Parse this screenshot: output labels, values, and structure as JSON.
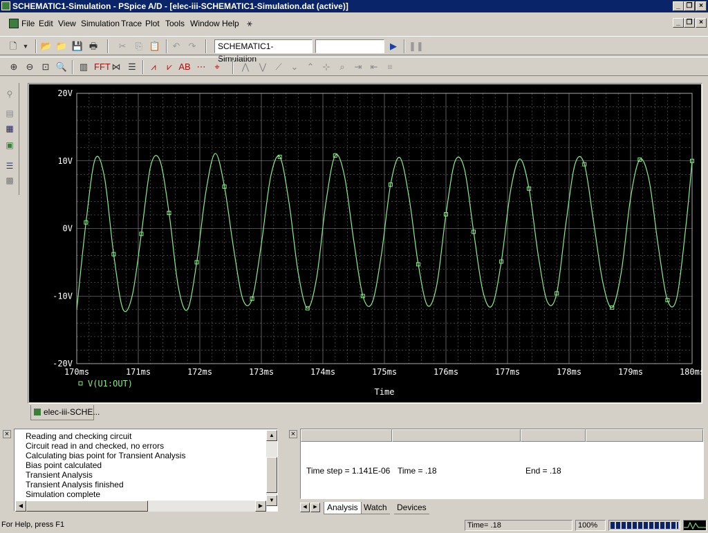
{
  "window": {
    "title": "SCHEMATIC1-Simulation - PSpice A/D  - [elec-iii-SCHEMATIC1-Simulation.dat (active)]"
  },
  "menu": [
    "File",
    "Edit",
    "View",
    "Simulation",
    "Trace",
    "Plot",
    "Tools",
    "Window",
    "Help"
  ],
  "toolbar": {
    "profile_select": "SCHEMATIC1-Simulation",
    "section_select": ""
  },
  "plot": {
    "tab_label": "elec-iii-SCHE...",
    "trace_name": "V(U1:OUT)",
    "xlabel": "Time",
    "colors": {
      "background": "#000000",
      "trace": "#88ee88",
      "grid": "#aaaaaa",
      "text": "#ffffff"
    }
  },
  "chart_data": {
    "type": "line",
    "title": "",
    "xlabel": "Time",
    "ylabel": "",
    "x_ticks": [
      "170ms",
      "171ms",
      "172ms",
      "173ms",
      "174ms",
      "175ms",
      "176ms",
      "177ms",
      "178ms",
      "179ms",
      "180ms"
    ],
    "y_ticks": [
      "20V",
      "10V",
      "0V",
      "-10V",
      "-20V"
    ],
    "xlim_ms": [
      170,
      180
    ],
    "ylim_V": [
      -20,
      20
    ],
    "grid": true,
    "series": [
      {
        "name": "V(U1:OUT)",
        "color": "#88ee88",
        "x_ms": [
          170.0,
          170.15,
          170.3,
          170.45,
          170.6,
          170.75,
          170.9,
          171.05,
          171.2,
          171.35,
          171.5,
          171.65,
          171.8,
          171.95,
          172.1,
          172.25,
          172.4,
          172.55,
          172.7,
          172.85,
          173.0,
          173.15,
          173.3,
          173.45,
          173.6,
          173.75,
          173.9,
          174.05,
          174.2,
          174.35,
          174.5,
          174.65,
          174.8,
          174.95,
          175.1,
          175.25,
          175.4,
          175.55,
          175.7,
          175.85,
          176.0,
          176.15,
          176.3,
          176.45,
          176.6,
          176.75,
          176.9,
          177.05,
          177.2,
          177.35,
          177.5,
          177.65,
          177.8,
          177.95,
          178.1,
          178.25,
          178.4,
          178.55,
          178.7,
          178.85,
          179.0,
          179.15,
          179.3,
          179.45,
          179.6,
          179.75,
          179.9,
          180.0
        ],
        "y_V": [
          -12.0,
          0.9,
          10.3,
          7.6,
          -3.8,
          -11.9,
          -10.0,
          -0.8,
          9.2,
          10.1,
          2.3,
          -8.6,
          -12.0,
          -5.0,
          5.5,
          11.1,
          6.2,
          -3.0,
          -10.5,
          -10.4,
          -2.3,
          7.6,
          10.6,
          3.8,
          -6.6,
          -11.8,
          -7.2,
          3.9,
          10.8,
          7.8,
          -1.7,
          -10.0,
          -11.0,
          -3.9,
          6.5,
          10.5,
          4.6,
          -5.3,
          -11.4,
          -8.4,
          2.1,
          10.0,
          8.8,
          -0.5,
          -9.3,
          -11.4,
          -4.9,
          5.6,
          10.3,
          5.9,
          -4.0,
          -10.9,
          -9.6,
          0.8,
          9.6,
          9.5,
          0.9,
          -8.0,
          -11.7,
          -6.4,
          4.5,
          10.2,
          7.2,
          -2.6,
          -10.6,
          -10.3,
          0.4,
          10.0
        ]
      }
    ]
  },
  "output_log": {
    "lines": [
      "Reading and checking circuit",
      "Circuit read in and checked, no errors",
      "Calculating bias point for Transient Analysis",
      "Bias point calculated",
      "Transient Analysis",
      "Transient Analysis finished",
      "Simulation complete"
    ]
  },
  "sim_status": {
    "time_step": "Time step =  1.141E-06",
    "time": "Time =  .18",
    "end": "End =  .18",
    "tabs": [
      "Analysis",
      "Watch",
      "Devices"
    ]
  },
  "statusbar": {
    "help": "For Help, press F1",
    "time": "Time= .18",
    "zoom": "100%"
  }
}
